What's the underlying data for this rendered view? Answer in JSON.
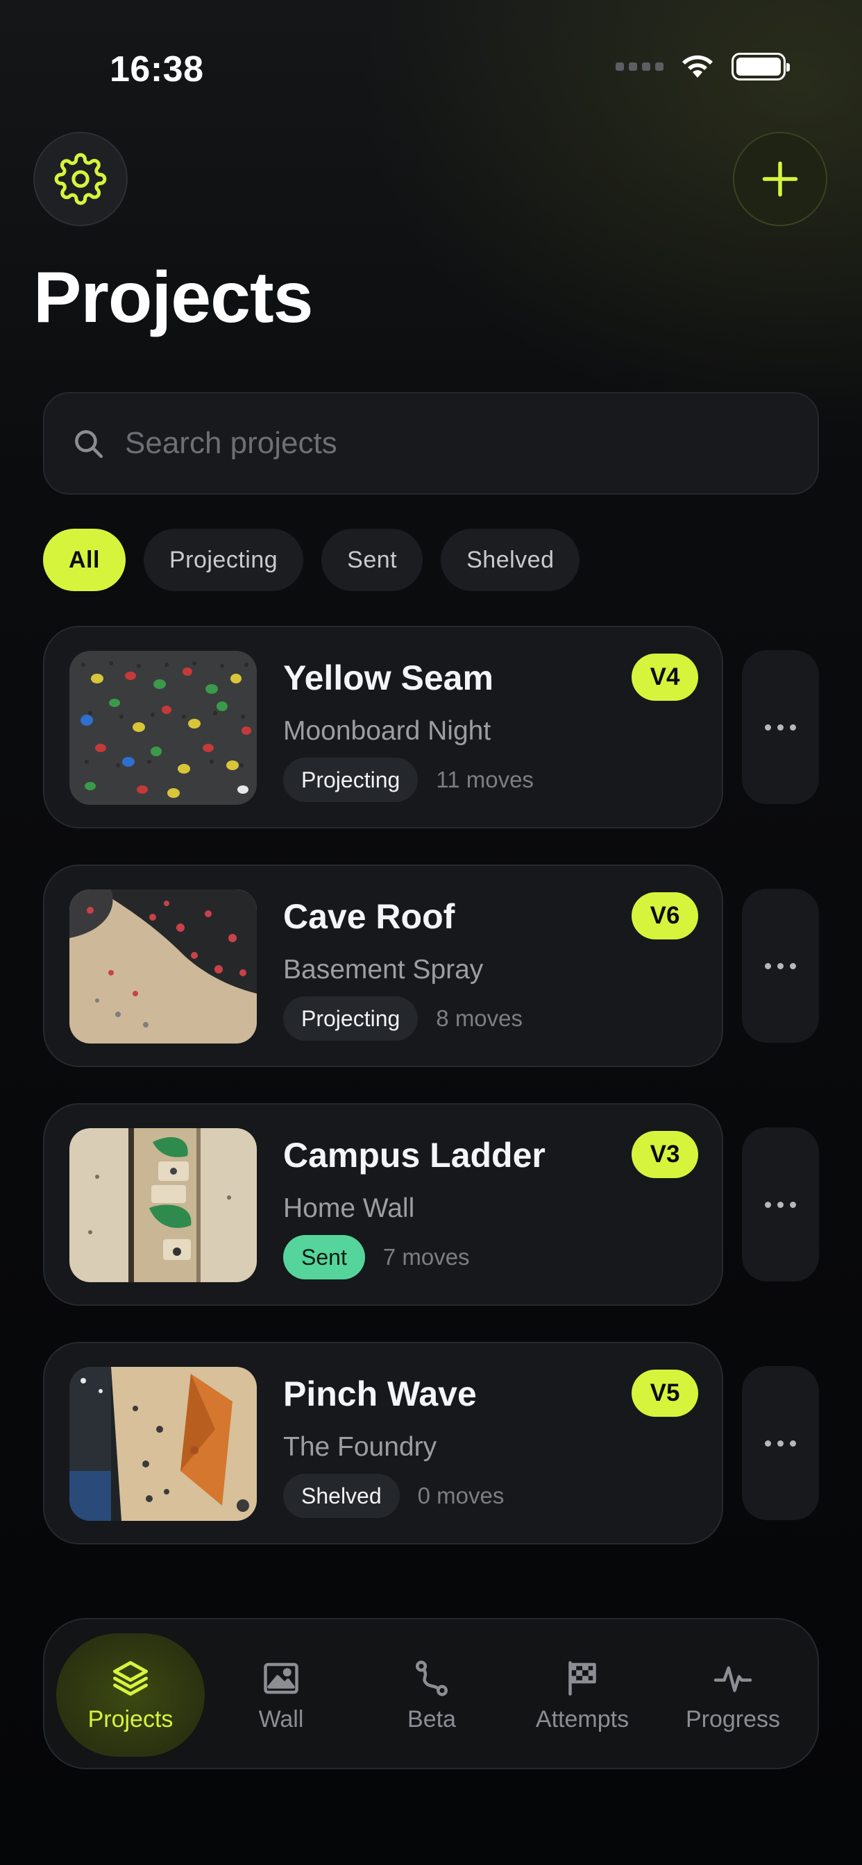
{
  "status_bar": {
    "time": "16:38"
  },
  "header": {
    "title": "Projects",
    "settings_icon": "gear-icon",
    "add_icon": "plus-icon"
  },
  "search": {
    "placeholder": "Search projects",
    "value": ""
  },
  "filters": [
    {
      "label": "All",
      "active": true
    },
    {
      "label": "Projecting",
      "active": false
    },
    {
      "label": "Sent",
      "active": false
    },
    {
      "label": "Shelved",
      "active": false
    }
  ],
  "projects": [
    {
      "name": "Yellow Seam",
      "wall": "Moonboard Night",
      "grade": "V4",
      "status": "Projecting",
      "moves": "11 moves",
      "image": "moonboard-photo"
    },
    {
      "name": "Cave Roof",
      "wall": "Basement Spray",
      "grade": "V6",
      "status": "Projecting",
      "moves": "8 moves",
      "image": "cave-roof-photo"
    },
    {
      "name": "Campus Ladder",
      "wall": "Home Wall",
      "grade": "V3",
      "status": "Sent",
      "moves": "7 moves",
      "image": "campus-board-photo"
    },
    {
      "name": "Pinch Wave",
      "wall": "The Foundry",
      "grade": "V5",
      "status": "Shelved",
      "moves": "0 moves",
      "image": "gym-wall-photo"
    }
  ],
  "tabbar": {
    "tabs": [
      {
        "label": "Projects",
        "icon": "layers-icon",
        "active": true
      },
      {
        "label": "Wall",
        "icon": "image-icon",
        "active": false
      },
      {
        "label": "Beta",
        "icon": "route-icon",
        "active": false
      },
      {
        "label": "Attempts",
        "icon": "checkered-flag-icon",
        "active": false
      },
      {
        "label": "Progress",
        "icon": "activity-icon",
        "active": false
      }
    ]
  },
  "colors": {
    "accent": "#d7f43c",
    "sent": "#55d59b",
    "card": "#16181b",
    "background": "#07080a"
  }
}
